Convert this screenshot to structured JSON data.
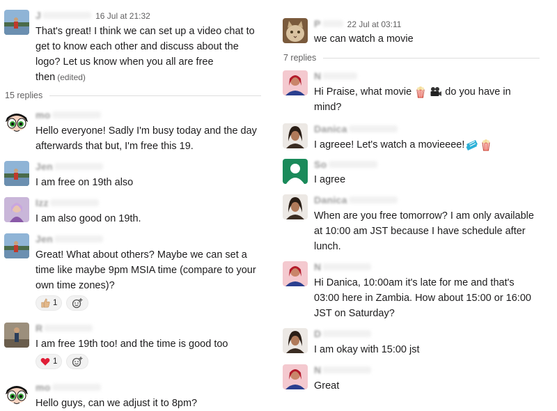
{
  "left": {
    "top_message": {
      "sender": "J",
      "time": "16 Jul at 21:32",
      "lines": [
        "That's great! I think we can set up a video chat to",
        "get to know each other and discuss about the",
        "logo? Let us know when you all are free",
        "then"
      ],
      "edited": "(edited)"
    },
    "replies_label": "15 replies",
    "messages": [
      {
        "sender": "mo",
        "avatar": "powerpuff",
        "lines": [
          "Hello everyone! Sadly I'm busy today and the day",
          "afterwards that but, I'm free this 19."
        ]
      },
      {
        "sender": "Jen",
        "avatar": "landscape",
        "lines": [
          "I am free on 19th also"
        ]
      },
      {
        "sender": "Izz",
        "avatar": "person-purple",
        "lines": [
          "I am also good on 19th."
        ]
      },
      {
        "sender": "Jen",
        "avatar": "landscape",
        "lines": [
          "Great! What about others? Maybe we can set a",
          "time like maybe 9pm MSIA time (compare to your",
          "own time zones)?"
        ],
        "reactions": [
          {
            "emoji": "thumbs-up",
            "count": "1"
          }
        ]
      },
      {
        "sender": "R",
        "avatar": "person-outdoor",
        "lines": [
          "I am free 19th too! and the time is good too"
        ],
        "reactions": [
          {
            "emoji": "heart",
            "count": "1"
          }
        ]
      },
      {
        "sender": "mo",
        "avatar": "powerpuff",
        "lines": [
          "Hello guys, can we adjust it to 8pm?"
        ]
      }
    ]
  },
  "right": {
    "top_message": {
      "sender": "P",
      "time": "22 Jul at 03:11",
      "lines": [
        "we can watch a movie"
      ]
    },
    "replies_label": "7 replies",
    "messages": [
      {
        "sender": "N",
        "avatar": "person-red",
        "lines_parts": [
          [
            "Hi Praise, what movie ",
            "{popcorn}",
            " ",
            "{camera}",
            " do you have in"
          ],
          [
            "mind?"
          ]
        ]
      },
      {
        "sender": "Danica",
        "avatar": "person-dark",
        "lines_parts": [
          [
            "I agreee! Let's watch a movieeee!",
            "{ticket}",
            "{popcorn}"
          ]
        ]
      },
      {
        "sender": "So",
        "avatar": "default-green",
        "lines": [
          "I agree"
        ]
      },
      {
        "sender": "Danica",
        "avatar": "person-dark",
        "lines": [
          "When are you free tomorrow? I am only available",
          "at 10:00 am JST because I have schedule after",
          "lunch."
        ]
      },
      {
        "sender": "N",
        "avatar": "person-red",
        "lines": [
          "Hi Danica, 10:00am it's late for me and that's",
          "03:00 here in Zambia. How about 15:00 or 16:00",
          "JST on Saturday?"
        ]
      },
      {
        "sender": "D",
        "avatar": "person-dark",
        "lines": [
          "I am okay with 15:00 jst"
        ]
      },
      {
        "sender": "N",
        "avatar": "person-red",
        "lines": [
          "Great"
        ]
      }
    ]
  },
  "icons": {
    "add_reaction": "add-reaction-icon"
  },
  "colors": {
    "text": "#1d1c1d",
    "muted": "#616061",
    "divider": "#dddddd",
    "reaction_bg": "#f2f2f2"
  }
}
